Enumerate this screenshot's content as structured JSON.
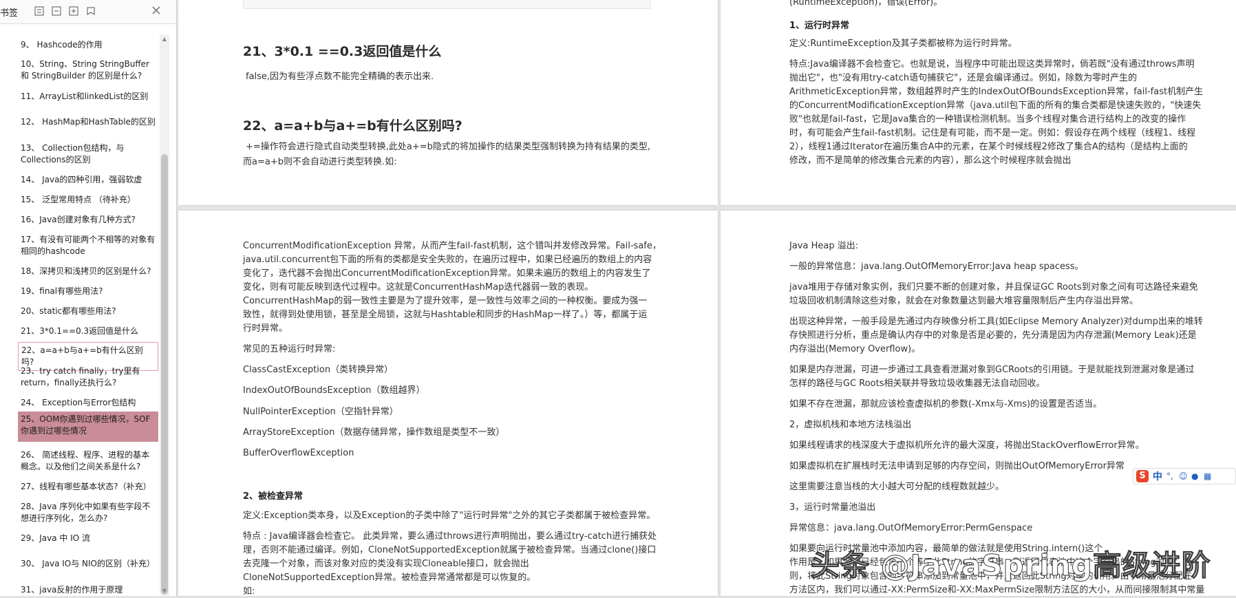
{
  "sidebar": {
    "title": "书签",
    "items": [
      {
        "label": "9、 Hashcode的作用"
      },
      {
        "label": "10、String、String StringBuffer 和 StringBuilder 的区别是什么?"
      },
      {
        "label": "11、ArrayList和linkedList的区别"
      },
      {
        "label": "12、 HashMap和HashTable的区别"
      },
      {
        "label": "13、 Collection包结构，与Collections的区别"
      },
      {
        "label": "14、 Java的四种引用，强弱软虚"
      },
      {
        "label": "15、 泛型常用特点 （待补充）"
      },
      {
        "label": "16、Java创建对象有几种方式?"
      },
      {
        "label": "17、有没有可能两个不相等的对象有相同的hashcode"
      },
      {
        "label": "18、深拷贝和浅拷贝的区别是什么?"
      },
      {
        "label": "19、final有哪些用法?"
      },
      {
        "label": "20、static都有哪些用法?"
      },
      {
        "label": "21、3*0.1==0.3返回值是什么"
      },
      {
        "label": "22、a=a+b与a+=b有什么区别吗?"
      },
      {
        "label": "23、try catch finally，try里有return，finally还执行么?"
      },
      {
        "label": "24、 Exception与Error包结构"
      },
      {
        "label": "25、OOM你遇到过哪些情况，SOF你遇到过哪些情况"
      },
      {
        "label": "26、 简述线程、程序、进程的基本概念。以及他们之间关系是什么?"
      },
      {
        "label": "27、线程有哪些基本状态?（补充）"
      },
      {
        "label": "28、Java 序列化中如果有些字段不想进行序列化，怎么办?"
      },
      {
        "label": "29、Java 中 IO 流"
      },
      {
        "label": "30、 Java IO与 NIO的区别（补充）"
      },
      {
        "label": "31、java反射的作用于原理"
      }
    ]
  },
  "page_tl": {
    "h21": "21、3*0.1 ==0.3返回值是什么",
    "p21": "false,因为有些浮点数不能完全精确的表示出来.",
    "h22": "22、a=a+b与a+=b有什么区别吗?",
    "p22a": "+=操作符会进行隐式自动类型转换,此处a+=b隐式的将加操作的结果类型强制转换为持有结果的类型,",
    "p22b": "而a=a+b则不会自动进行类型转换.如:"
  },
  "page_tr": {
    "top": "(RuntimeException)，错误(Error)。",
    "h1": "1、运行时异常",
    "def": "定义:RuntimeException及其子类都被称为运行时异常。",
    "l1": "特点:Java编译器不会检查它。也就是说，当程序中可能出现这类异常时，倘若既\"没有通过throws声明",
    "l2": "抛出它\"，也\"没有用try-catch语句捕获它\"，还是会编译通过。例如，除数为零时产生的",
    "l3": "ArithmeticException异常，数组越界时产生的IndexOutOfBoundsException异常，fail-fast机制产生",
    "l4": "的ConcurrentModificationException异常（java.util包下面的所有的集合类都是快速失败的，\"快速失",
    "l5": "败\"也就是fail-fast，它是Java集合的一种错误检测机制。当多个线程对集合进行结构上的改变的操作",
    "l6": "时，有可能会产生fail-fast机制。记住是有可能，而不是一定。例如：假设存在两个线程（线程1、线程",
    "l7": "2），线程1通过Iterator在遍历集合A中的元素，在某个时候线程2修改了集合A的结构（是结构上面的",
    "l8": "修改，而不是简单的修改集合元素的内容），那么这个时候程序就会抛出"
  },
  "page_bl": {
    "l1": "ConcurrentModificationException 异常，从而产生fail-fast机制，这个错叫并发修改异常。Fail-safe，",
    "l2": "java.util.concurrent包下面的所有的类都是安全失败的，在遍历过程中，如果已经遍历的数组上的内容",
    "l3": "变化了，迭代器不会抛出ConcurrentModificationException异常。如果未遍历的数组上的内容发生了",
    "l4": "变化，则有可能反映到迭代过程中。这就是ConcurrentHashMap迭代器弱一致的表现。",
    "l5": "ConcurrentHashMap的弱一致性主要是为了提升效率，是一致性与效率之间的一种权衡。要成为强一",
    "l6": "致性，就得到处使用锁，甚至是全局锁，这就与Hashtable和同步的HashMap一样了。）等，都属于运",
    "l7": "行时异常。",
    "common": "常见的五种运行时异常:",
    "e1": "ClassCastException（类转换异常）",
    "e2": "IndexOutOfBoundsException（数组越界）",
    "e3": "NullPointerException（空指针异常）",
    "e4": "ArrayStoreException（数据存储异常，操作数组是类型不一致）",
    "e5": "BufferOverflowException",
    "h2": "2、被检查异常",
    "def": "定义:Exception类本身，以及Exception的子类中除了\"运行时异常\"之外的其它子类都属于被检查异常。",
    "s1": "特点 : Java编译器会检查它。 此类异常，要么通过throws进行声明抛出，要么通过try-catch进行捕获处",
    "s2": "理，否则不能通过编译。例如，CloneNotSupportedException就属于被检查异常。当通过clone()接口",
    "s3": "去克隆一个对象，而该对象对应的类没有实现Cloneable接口，就会抛出",
    "s4": "CloneNotSupportedException异常。被检查异常通常都是可以恢复的。",
    "s5": "如:"
  },
  "page_br": {
    "a1": "Java Heap 溢出:",
    "a2": "一般的异常信息：java.lang.OutOfMemoryError:Java heap spacess。",
    "b1": "java堆用于存储对象实例，我们只要不断的创建对象，并且保证GC Roots到对象之间有可达路径来避免",
    "b2": "垃圾回收机制清除这些对象，就会在对象数量达到最大堆容量限制后产生内存溢出异常。",
    "c1": "出现这种异常，一般手段是先通过内存映像分析工具(如Eclipse Memory Analyzer)对dump出来的堆转",
    "c2": "存快照进行分析，重点是确认内存中的对象是否是必要的，先分清是因为内存泄漏(Memory Leak)还是",
    "c3": "内存溢出(Memory Overflow)。",
    "d1": "如果是内存泄漏，可进一步通过工具查看泄漏对象到GCRoots的引用链。于是就能找到泄漏对象是通过",
    "d2": "怎样的路径与GC Roots相关联并导致垃圾收集器无法自动回收。",
    "e1": "如果不存在泄漏，那就应该检查虚拟机的参数(-Xmx与-Xms)的设置是否适当。",
    "f1": "2，虚拟机栈和本地方法栈溢出",
    "g1": "如果线程请求的栈深度大于虚拟机所允许的最大深度，将抛出StackOverflowError异常。",
    "h1": "如果虚拟机在扩展栈时无法申请到足够的内存空间，则抛出OutOfMemoryError异常",
    "i1": "这里需要注意当栈的大小越大可分配的线程数就越少。",
    "j1": "3，运行时常量池溢出",
    "k1": "异常信息：java.lang.OutOfMemoryError:PermGenspace",
    "l1": "如果要向运行时常量池中添加内容，最简单的做法就是使用String.intern()这个",
    "l2": "作用是：如果池中已经包含一个等于此String的字符串，则返回代表池中这个字符串的String对象；否",
    "l3": "则，将此String对象包含的字符串添加到常量池中，并且返回此String对象的引用。由于常量池分配在",
    "l4": "方法区内，我们可以通过-XX:PermSize和-XX:MaxPermSize限制方法区的大小，从而间接限制其中常量"
  },
  "overlay": {
    "watermark": "头条 @JavaSpring高级进阶",
    "ime_cn": "中"
  },
  "colors": {
    "selected_item": "#c98c98",
    "outlined_item": "#e59aa6"
  }
}
